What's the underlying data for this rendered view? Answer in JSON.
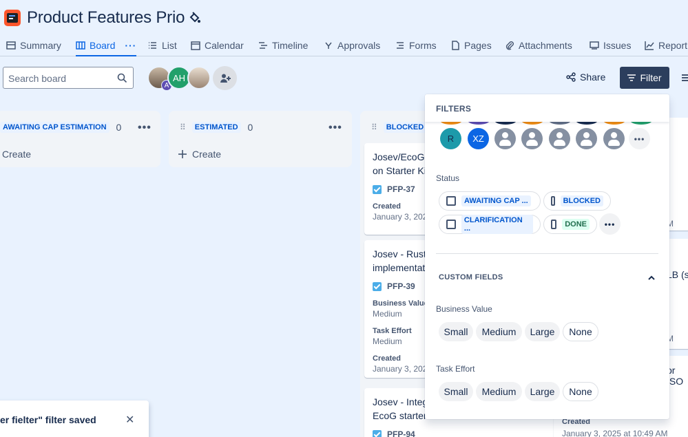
{
  "header": {
    "title": "Product Features Prio"
  },
  "tabs": [
    {
      "label": "Summary",
      "icon": "summary-icon"
    },
    {
      "label": "Board",
      "icon": "board-icon",
      "more": "···"
    },
    {
      "label": "List",
      "icon": "list-icon"
    },
    {
      "label": "Calendar",
      "icon": "calendar-icon"
    },
    {
      "label": "Timeline",
      "icon": "timeline-icon"
    },
    {
      "label": "Approvals",
      "icon": "approvals-icon"
    },
    {
      "label": "Forms",
      "icon": "forms-icon"
    },
    {
      "label": "Pages",
      "icon": "pages-icon"
    },
    {
      "label": "Attachments",
      "icon": "attachments-icon"
    },
    {
      "label": "Issues",
      "icon": "issues-icon"
    },
    {
      "label": "Report",
      "icon": "reports-icon"
    }
  ],
  "toolbar": {
    "search_placeholder": "Search board",
    "avatars": [
      "",
      "AH",
      ""
    ],
    "avatar_badge": "A",
    "share_label": "Share",
    "filter_label": "Filter"
  },
  "columns": [
    {
      "name": "AWAITING CAP ESTIMATION",
      "count": "0",
      "create": "Create"
    },
    {
      "name": "ESTIMATED",
      "count": "0",
      "create": "Create"
    },
    {
      "name": "BLOCKED"
    }
  ],
  "cards": [
    {
      "title_l1": "Josev/EcoG -",
      "title_l2": "on Starter Ki",
      "key": "PFP-37",
      "created_label": "Created",
      "created": "January 3, 202"
    },
    {
      "title_l1": "Josev - Rust",
      "title_l2": "implementat",
      "key": "PFP-39",
      "bv_label": "Business Value",
      "bv": "Medium",
      "te_label": "Task Effort",
      "te": "Medium",
      "created_label": "Created",
      "created": "January 3, 202"
    },
    {
      "title_l1": "Josev - Integ",
      "title_l2": "EcoG starter",
      "key": "PFP-94"
    }
  ],
  "right_cards": {
    "m_fragment": "M",
    "lb_fragment": "LB (s",
    "m2_fragment": "M",
    "or_fragment": "or ISO",
    "created_label": "Created",
    "created": "January 3, 2025 at 10:49 AM"
  },
  "toast": {
    "message": "er fielter\" filter saved"
  },
  "filters_panel": {
    "heading": "FILTERS",
    "people": [
      {
        "initials": "R",
        "color": "#1d9aaa"
      },
      {
        "initials": "XZ",
        "color": "#0c66e4"
      }
    ],
    "status_label": "Status",
    "statuses": [
      {
        "label": "AWAITING CAP ...",
        "style": "blue"
      },
      {
        "label": "BLOCKED",
        "style": "blue"
      },
      {
        "label": "CLARIFICATION ...",
        "style": "blue"
      },
      {
        "label": "DONE",
        "style": "green"
      }
    ],
    "custom_fields_label": "CUSTOM FIELDS",
    "business_value_label": "Business Value",
    "business_value_options": [
      "Small",
      "Medium",
      "Large",
      "None"
    ],
    "task_effort_label": "Task Effort",
    "task_effort_options": [
      "Small",
      "Medium",
      "Large",
      "None"
    ]
  },
  "colors": {
    "accent": "#0c66e4",
    "filter_button": "#2c3e5d",
    "background": "#e9f2fe"
  }
}
